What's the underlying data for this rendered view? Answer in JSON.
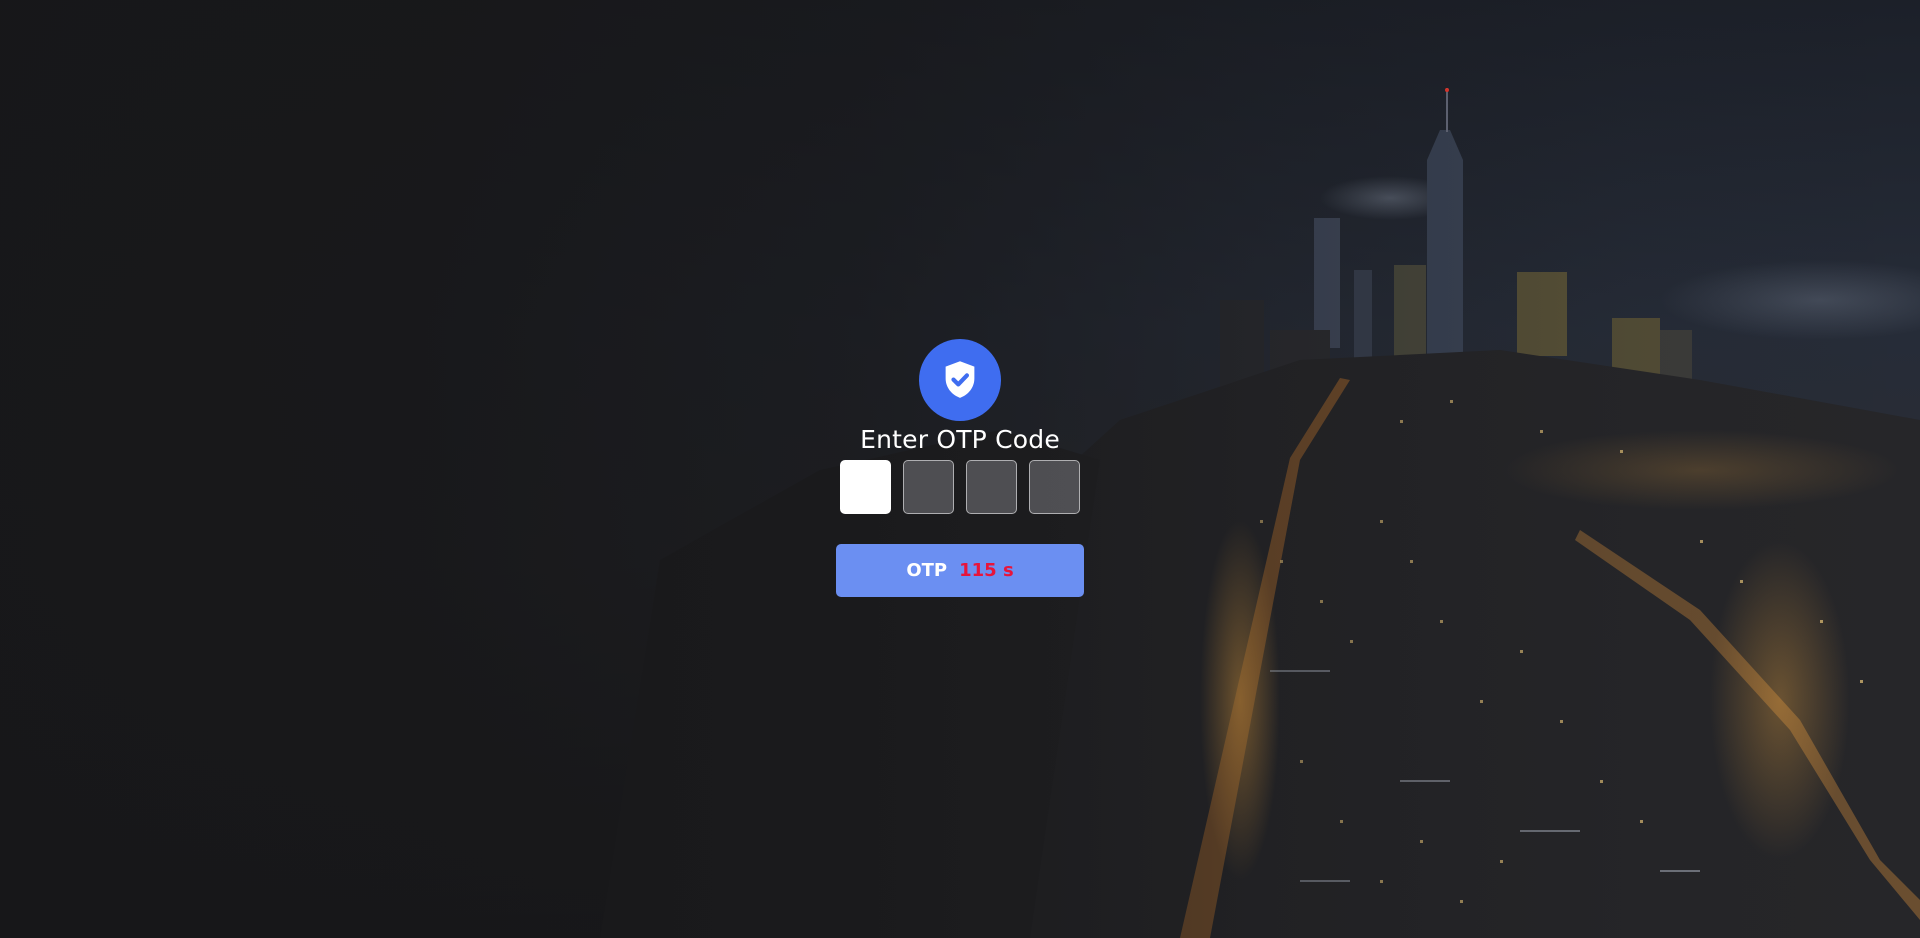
{
  "page": {
    "title": "Enter OTP Code"
  },
  "otp": {
    "digits": [
      "",
      "",
      "",
      ""
    ],
    "active_index": 0
  },
  "button": {
    "label": "OTP",
    "timer_value": "115 s"
  },
  "icons": {
    "header": "shield-check-icon"
  },
  "colors": {
    "accent": "#3f6df0",
    "button": "#6b8ff2",
    "timer": "#e8143b"
  }
}
